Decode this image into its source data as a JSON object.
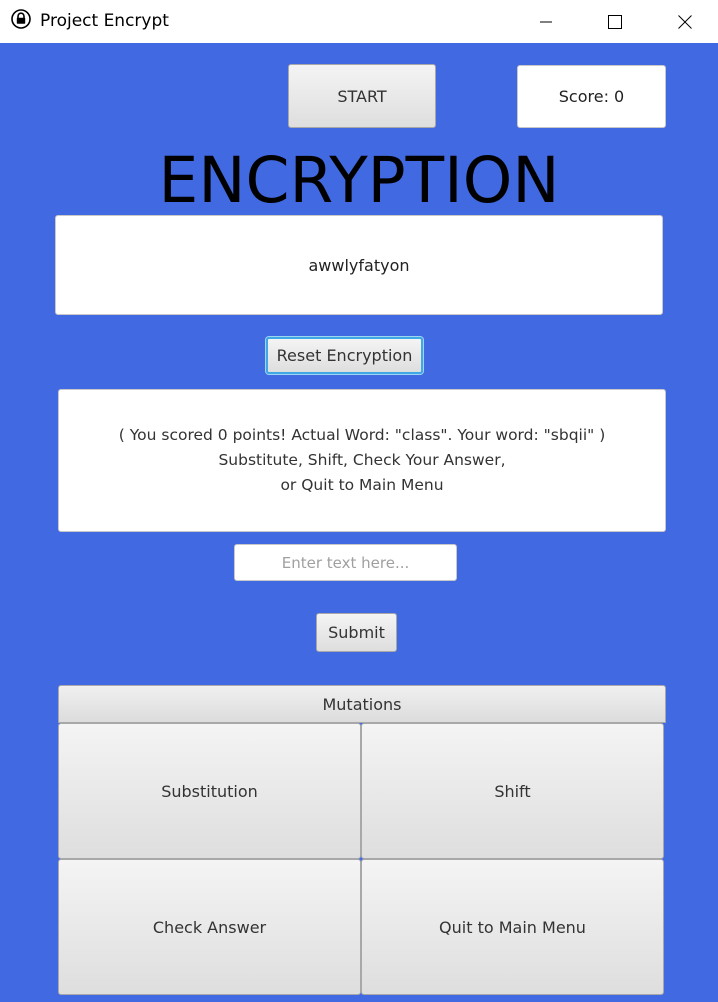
{
  "window": {
    "title": "Project Encrypt",
    "icon": "lock-icon"
  },
  "colors": {
    "background": "#4169e1"
  },
  "header": {
    "start_label": "START",
    "score_text": "Score: 0"
  },
  "heading": "ENCRYPTION",
  "encrypted_word": "awwlyfatyon",
  "reset_label": "Reset Encryption",
  "message": {
    "line1": "( You scored 0 points! Actual Word: \"class\". Your word: \"sbqii\" )",
    "line2": "Substitute, Shift, Check Your Answer,",
    "line3": "or Quit to Main Menu"
  },
  "input": {
    "placeholder": "Enter text here...",
    "value": ""
  },
  "submit_label": "Submit",
  "mutations": {
    "title": "Mutations",
    "substitution": "Substitution",
    "shift": "Shift",
    "check_answer": "Check Answer",
    "quit": "Quit to Main Menu"
  }
}
